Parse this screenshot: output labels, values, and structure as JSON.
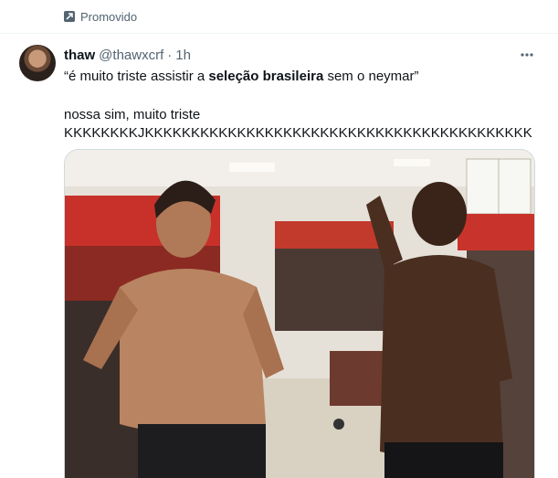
{
  "promo": {
    "label": "Promovido",
    "icon": "promoted-icon"
  },
  "tweet": {
    "display_name": "thaw",
    "handle": "@thawxcrf",
    "separator": "·",
    "time": "1h",
    "line1_part1": "“é muito triste assistir a ",
    "line1_bold": "seleção brasileira",
    "line1_part2": " sem o neymar”",
    "line2": "nossa sim, muito triste",
    "line3": "KKKKKKKKJKKKKKKKKKKKKKKKKKKKKKKKKKKKKKKKKKKKKKKKKKK",
    "more_icon": "more-horizontal-icon"
  },
  "colors": {
    "text": "#0f1419",
    "muted": "#536471",
    "border": "#cfd9de"
  }
}
